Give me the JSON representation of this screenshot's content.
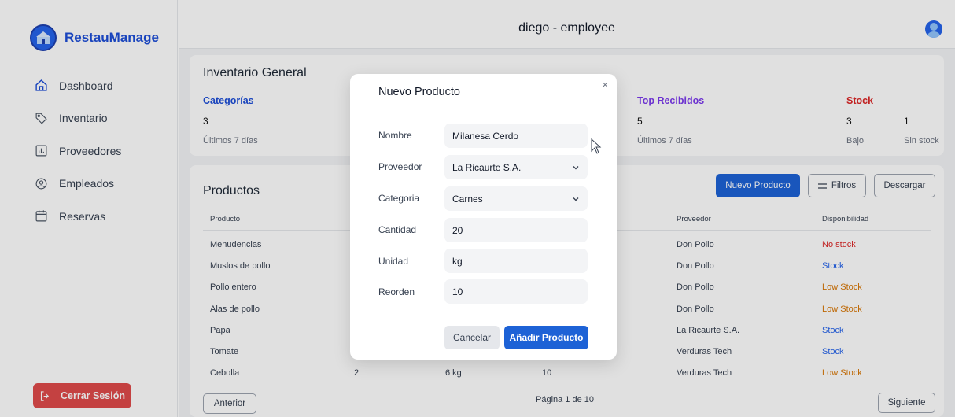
{
  "sidebar": {
    "brand": "RestauManage",
    "items": [
      {
        "label": "Dashboard",
        "icon": "home-icon"
      },
      {
        "label": "Inventario",
        "icon": "tag-icon"
      },
      {
        "label": "Proveedores",
        "icon": "chart-icon"
      },
      {
        "label": "Empleados",
        "icon": "user-icon"
      },
      {
        "label": "Reservas",
        "icon": "calendar-icon"
      }
    ],
    "logout_label": "Cerrar Sesión"
  },
  "header": {
    "title": "diego - employee"
  },
  "inventory": {
    "title": "Inventario General",
    "categorias": {
      "label": "Categorías",
      "value": "3",
      "sub": "Últimos 7 días"
    },
    "top_recibidos": {
      "label": "Top Recibidos",
      "value": "5",
      "sub": "Últimos 7 días"
    },
    "stock": {
      "label": "Stock",
      "bajo_value": "3",
      "sin_value": "1",
      "bajo_label": "Bajo",
      "sin_label": "Sin stock"
    }
  },
  "products": {
    "title": "Productos",
    "new_button": "Nuevo Producto",
    "filters_button": "Filtros",
    "download_button": "Descargar",
    "columns": {
      "producto": "Producto",
      "proveedor": "Proveedor",
      "disponibilidad": "Disponibilidad"
    },
    "rows": [
      {
        "name": "Menudencias",
        "supplier": "Don Pollo",
        "availability": "No stock"
      },
      {
        "name": "Muslos de pollo",
        "supplier": "Don Pollo",
        "availability": "Stock"
      },
      {
        "name": "Pollo entero",
        "supplier": "Don Pollo",
        "availability": "Low Stock"
      },
      {
        "name": "Alas de pollo",
        "supplier": "Don Pollo",
        "availability": "Low Stock"
      },
      {
        "name": "Papa",
        "supplier": "La Ricaurte S.A.",
        "availability": "Stock"
      },
      {
        "name": "Tomate",
        "supplier": "Verduras Tech",
        "availability": "Stock"
      },
      {
        "name": "Cebolla",
        "c2": "2",
        "c3": "6 kg",
        "c4": "10",
        "supplier": "Verduras Tech",
        "availability": "Low Stock"
      }
    ],
    "prev_button": "Anterior",
    "page_text": "Página 1 de 10",
    "next_button": "Siguiente"
  },
  "modal": {
    "title": "Nuevo Producto",
    "close": "×",
    "fields": {
      "nombre": {
        "label": "Nombre",
        "value": "Milanesa Cerdo"
      },
      "proveedor": {
        "label": "Proveedor",
        "value": "La Ricaurte S.A."
      },
      "categoria": {
        "label": "Categoria",
        "value": "Carnes"
      },
      "cantidad": {
        "label": "Cantidad",
        "value": "20"
      },
      "unidad": {
        "label": "Unidad",
        "value": "kg"
      },
      "reorden": {
        "label": "Reorden",
        "value": "10"
      }
    },
    "cancel_button": "Cancelar",
    "add_button": "Añadir Producto"
  },
  "colors": {
    "primary": "#1d62d6",
    "danger": "#e04a4a",
    "stat_blue": "#1d4ed8",
    "stat_purple": "#7c3aed",
    "stat_red": "#dc2626",
    "no_stock": "#dc2626",
    "stock": "#2563eb",
    "low_stock": "#d97706"
  }
}
